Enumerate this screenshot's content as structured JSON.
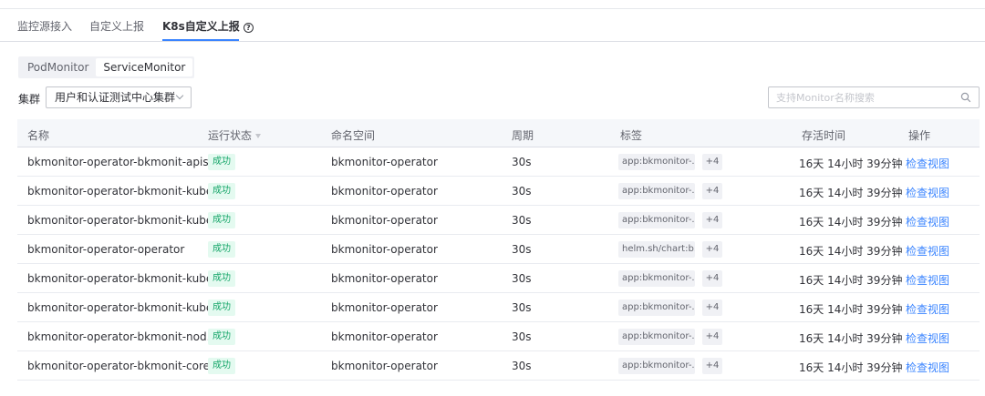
{
  "tabs": [
    {
      "label": "监控源接入"
    },
    {
      "label": "自定义上报"
    },
    {
      "label": "K8s自定义上报"
    }
  ],
  "monitor_types": [
    "PodMonitor",
    "ServiceMonitor"
  ],
  "cluster": {
    "label": "集群",
    "selected": "用户和认证测试中心集群"
  },
  "search": {
    "placeholder": "支持Monitor名称搜索"
  },
  "table": {
    "headers": {
      "name": "名称",
      "status": "运行状态",
      "namespace": "命名空间",
      "period": "周期",
      "labels": "标签",
      "uptime": "存活时间",
      "action": "操作"
    },
    "rows": [
      {
        "name": "bkmonitor-operator-bkmonit-apis...",
        "status": "成功",
        "namespace": "bkmonitor-operator",
        "period": "30s",
        "tag": "app:bkmonitor-...",
        "more": "+4",
        "uptime": "16天 14小时 39分钟",
        "action": "检查视图"
      },
      {
        "name": "bkmonitor-operator-bkmonit-kube...",
        "status": "成功",
        "namespace": "bkmonitor-operator",
        "period": "30s",
        "tag": "app:bkmonitor-...",
        "more": "+4",
        "uptime": "16天 14小时 39分钟",
        "action": "检查视图"
      },
      {
        "name": "bkmonitor-operator-bkmonit-kube...",
        "status": "成功",
        "namespace": "bkmonitor-operator",
        "period": "30s",
        "tag": "app:bkmonitor-...",
        "more": "+4",
        "uptime": "16天 14小时 39分钟",
        "action": "检查视图"
      },
      {
        "name": "bkmonitor-operator-operator",
        "status": "成功",
        "namespace": "bkmonitor-operator",
        "period": "30s",
        "tag": "helm.sh/chart:b...",
        "more": "+4",
        "uptime": "16天 14小时 39分钟",
        "action": "检查视图"
      },
      {
        "name": "bkmonitor-operator-bkmonit-kube...",
        "status": "成功",
        "namespace": "bkmonitor-operator",
        "period": "30s",
        "tag": "app:bkmonitor-...",
        "more": "+4",
        "uptime": "16天 14小时 39分钟",
        "action": "检查视图"
      },
      {
        "name": "bkmonitor-operator-bkmonit-kube...",
        "status": "成功",
        "namespace": "bkmonitor-operator",
        "period": "30s",
        "tag": "app:bkmonitor-...",
        "more": "+4",
        "uptime": "16天 14小时 39分钟",
        "action": "检查视图"
      },
      {
        "name": "bkmonitor-operator-bkmonit-nod...",
        "status": "成功",
        "namespace": "bkmonitor-operator",
        "period": "30s",
        "tag": "app:bkmonitor-...",
        "more": "+4",
        "uptime": "16天 14小时 39分钟",
        "action": "检查视图"
      },
      {
        "name": "bkmonitor-operator-bkmonit-core...",
        "status": "成功",
        "namespace": "bkmonitor-operator",
        "period": "30s",
        "tag": "app:bkmonitor-...",
        "more": "+4",
        "uptime": "16天 14小时 39分钟",
        "action": "检查视图"
      }
    ]
  },
  "colors": {
    "accent": "#3a84ff",
    "success_text": "#14a568",
    "success_bg": "#e4faf0"
  }
}
